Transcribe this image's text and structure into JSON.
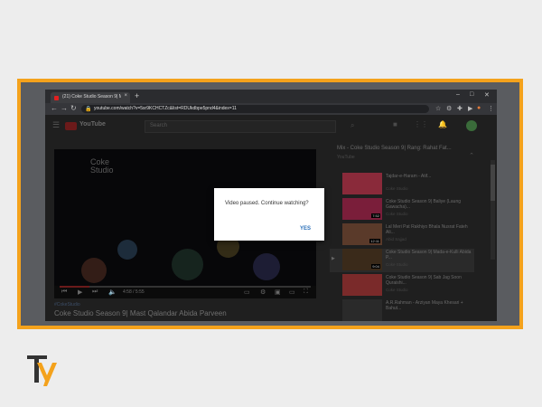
{
  "browser": {
    "tab_title": "(21) Coke Studio Season 9| Ma...",
    "tab_close": "×",
    "new_tab": "+",
    "window_controls": [
      "–",
      "□",
      "✕"
    ],
    "url": "youtube.com/watch?v=5sr9KCHCTZc&list=RDUkdbpe5pnd4&index=11"
  },
  "youtube": {
    "brand": "YouTube",
    "search_placeholder": "Search"
  },
  "video": {
    "overlay_title_1": "Coke",
    "overlay_title_2": "Studio",
    "time": "4:58 / 5:55",
    "progress": 0.12,
    "hashtag": "#CokeStudio",
    "title": "Coke Studio Season 9| Mast Qalandar Abida Parveen"
  },
  "playlist": {
    "title": "Mix - Coke Studio Season 9| Rang: Rahat Fat...",
    "subtitle": "YouTube",
    "items": [
      {
        "title": "Tajdar-e-Haram - Atif...",
        "channel": "Coke Studio",
        "duration": "",
        "color": "#8a2a3a"
      },
      {
        "title": "Coke Studio Season 9| Baliye (Laung Gawacha)...",
        "channel": "Coke Studio",
        "duration": "7:52",
        "color": "#7a1e3a"
      },
      {
        "title": "Lal Meri Pat Rakhiyo Bhala Nusrat Fateh Ali...",
        "channel": "Abid Sajjad",
        "duration": "12:11",
        "color": "#5a3a2a"
      },
      {
        "title": "Coke Studio Season 9| Mada-e-Kulli Abida P...",
        "channel": "Coke Studio",
        "duration": "9:04",
        "color": "#3a2a1a"
      },
      {
        "title": "Coke Studio Season 9| Sab Jag Soon Quraishi...",
        "channel": "Coke Studio",
        "duration": "",
        "color": "#7a2a2a"
      },
      {
        "title": "A.R.Rahman - Arziyan Maya Khesari + Bahut...",
        "channel": "",
        "duration": "",
        "color": "#2a2a2a"
      }
    ]
  },
  "dialog": {
    "message": "Video paused. Continue watching?",
    "yes": "YES"
  }
}
